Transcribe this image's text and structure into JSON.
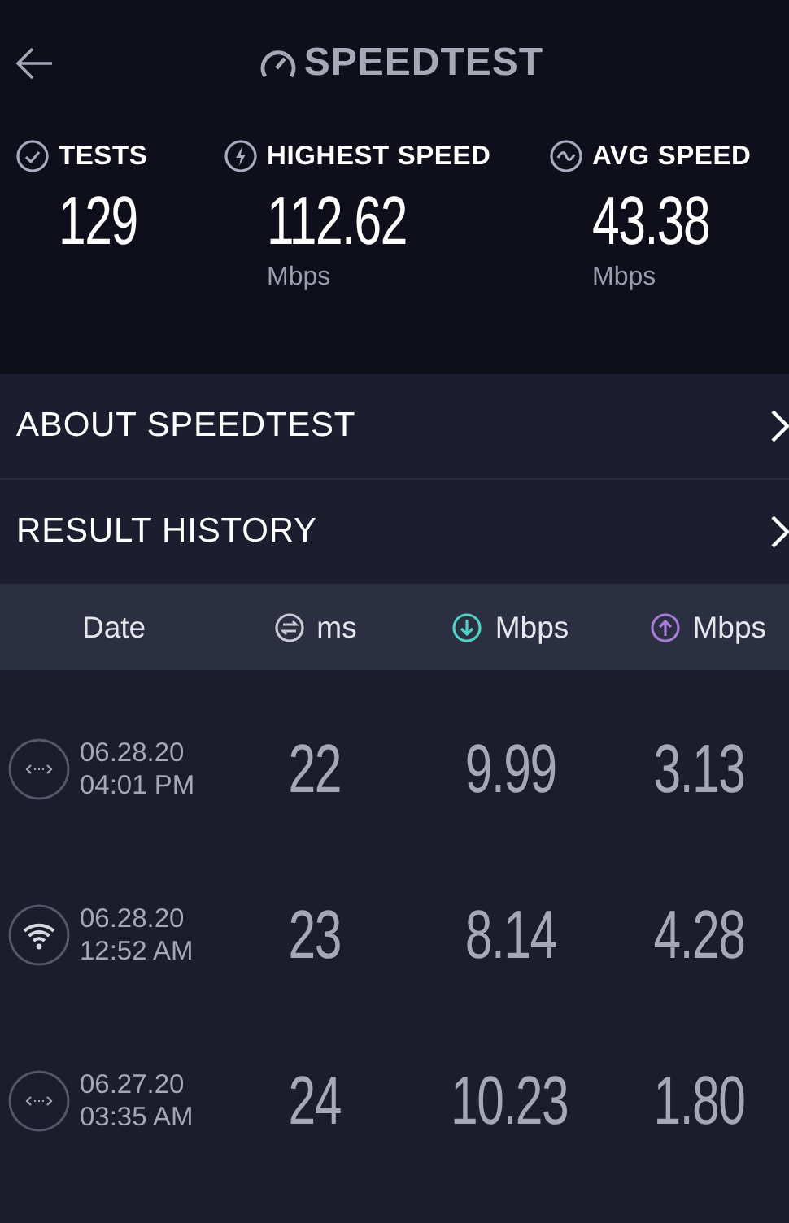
{
  "header": {
    "title": "SPEEDTEST"
  },
  "stats": [
    {
      "kind": "tests",
      "label": "TESTS",
      "value": "129"
    },
    {
      "kind": "highest",
      "label": "HIGHEST SPEED",
      "value": "112.62",
      "unit": "Mbps"
    },
    {
      "kind": "average",
      "label": "AVG SPEED",
      "value": "43.38",
      "unit": "Mbps"
    }
  ],
  "menu": [
    {
      "label": "ABOUT SPEEDTEST"
    },
    {
      "label": "RESULT HISTORY"
    }
  ],
  "table": {
    "columns": [
      {
        "kind": "date",
        "label": "Date"
      },
      {
        "kind": "ping",
        "label": "ms"
      },
      {
        "kind": "download",
        "label": "Mbps"
      },
      {
        "kind": "upload",
        "label": "Mbps"
      }
    ],
    "rows": [
      {
        "kind": "ethernet",
        "date": "06.28.20",
        "time": "04:01 PM",
        "ping": "22",
        "download": "9.99",
        "upload": "3.13"
      },
      {
        "kind": "wifi",
        "date": "06.28.20",
        "time": "12:52 AM",
        "ping": "23",
        "download": "8.14",
        "upload": "4.28"
      },
      {
        "kind": "ethernet",
        "date": "06.27.20",
        "time": "03:35 AM",
        "ping": "24",
        "download": "10.23",
        "upload": "1.80"
      }
    ]
  }
}
